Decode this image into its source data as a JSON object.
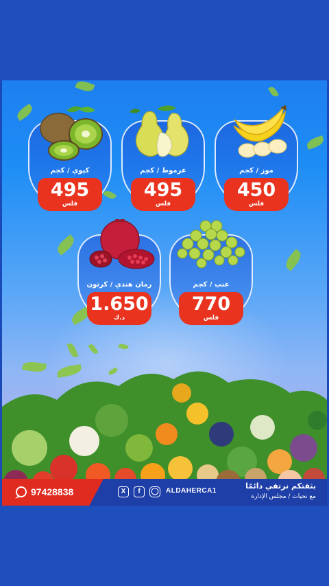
{
  "products": [
    {
      "name_unit": "موز / كجم",
      "price": "450",
      "currency": "فلس",
      "icon": "banana-icon"
    },
    {
      "name_unit": "عرموط / كجم",
      "price": "495",
      "currency": "فلس",
      "icon": "pear-icon"
    },
    {
      "name_unit": "كيوي / كجم",
      "price": "495",
      "currency": "فلس",
      "icon": "kiwi-icon"
    },
    {
      "name_unit": "عنب / كجم",
      "price": "770",
      "currency": "فلس",
      "icon": "grapes-icon"
    },
    {
      "name_unit": "رمان هندي / كرتون",
      "price": "1.650",
      "currency": "د.ك",
      "icon": "pomegranate-icon"
    }
  ],
  "footer": {
    "phone": "97428838",
    "handle": "ALDAHERCA1",
    "slogan": "بثقتكم نرتقي دائمًا",
    "signoff": "مع تحيات / مجلس الإدارة",
    "social_icons": [
      "whatsapp-icon",
      "x-icon",
      "facebook-icon",
      "instagram-icon"
    ]
  },
  "colors": {
    "price_badge": "#e9331f",
    "footer_blue": "#1e3ea8",
    "footer_red": "#e02b20",
    "frame_blue": "#1f4ebd"
  }
}
